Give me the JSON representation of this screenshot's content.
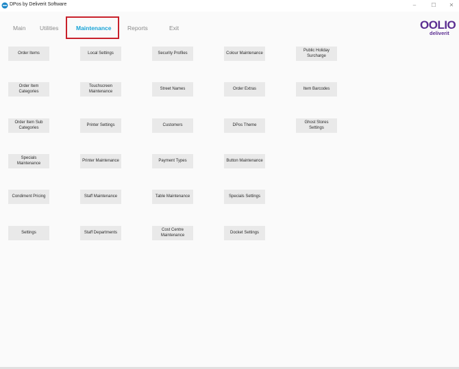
{
  "window": {
    "title": "DPos by Deliverit Software",
    "controls": {
      "minimize": "–",
      "maximize": "☐",
      "close": "✕"
    }
  },
  "nav": {
    "tabs": [
      {
        "label": "Main"
      },
      {
        "label": "Utilities"
      },
      {
        "label": "Maintenance",
        "active": true
      },
      {
        "label": "Reports"
      },
      {
        "label": "Exit"
      }
    ]
  },
  "logo": {
    "main": "OOLIO",
    "sub": "deliverit"
  },
  "colors": {
    "accent": "#17a3d6",
    "highlight": "#c8202a",
    "brand": "#5b2d91",
    "tile": "#e9e9e9"
  },
  "tiles": [
    [
      "Order Items",
      "Local Settings",
      "Security Profiles",
      "Colour Maintenance",
      "Public Holiday Surcharge"
    ],
    [
      "Order Item Categories",
      "Touchscreen Maintenance",
      "Street Names",
      "Order Extras",
      "Item Barcodes"
    ],
    [
      "Order Item Sub Categories",
      "Printer Settings",
      "Customers",
      "DPos Theme",
      "Ghost Stores Settings"
    ],
    [
      "Specials Maintenance",
      "Printer Maintenance",
      "Payment Types",
      "Button Maintenance"
    ],
    [
      "Condiment Pricing",
      "Staff Maintenance",
      "Table Maintenance",
      "Specials Settings"
    ],
    [
      "Settings",
      "Staff Departments",
      "Cost Centre Maintenance",
      "Docket Settings"
    ]
  ]
}
